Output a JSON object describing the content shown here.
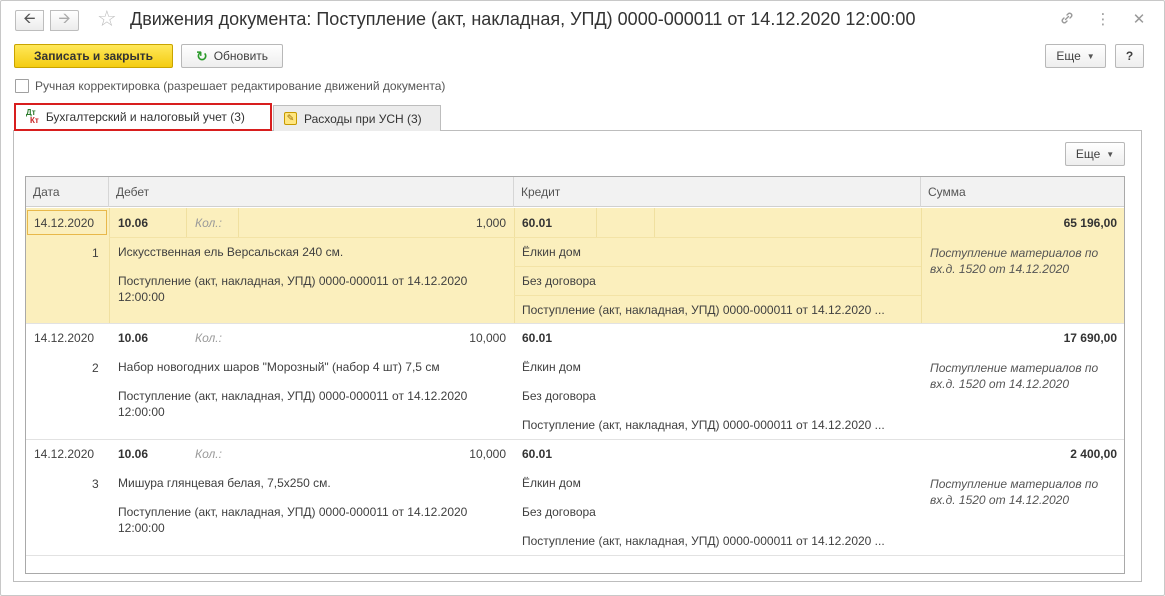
{
  "window": {
    "title": "Движения документа: Поступление (акт, накладная, УПД) 0000-000011 от 14.12.2020 12:00:00"
  },
  "toolbar": {
    "save_close_label": "Записать и закрыть",
    "refresh_label": "Обновить",
    "more_label": "Еще",
    "help_label": "?"
  },
  "manual_check": {
    "label": "Ручная корректировка (разрешает редактирование движений документа)",
    "checked": false
  },
  "tabs": [
    {
      "label": "Бухгалтерский и налоговый учет (3)",
      "icon_dt": "Дт",
      "icon_kt": "Кт",
      "active": true
    },
    {
      "label": "Расходы при УСН (3)",
      "active": false
    }
  ],
  "table_toolbar": {
    "more_label": "Еще"
  },
  "columns": {
    "date": "Дата",
    "debit": "Дебет",
    "credit": "Кредит",
    "sum": "Сумма"
  },
  "records": [
    {
      "date": "14.12.2020",
      "num": "1",
      "debit_account": "10.06",
      "qty_label": "Кол.:",
      "qty": "1,000",
      "debit_sub1": "Искусственная ель Версальская 240 см.",
      "debit_sub2_l1": "Поступление (акт, накладная, УПД) 0000-000011 от 14.12.2020",
      "debit_sub2_l2": "12:00:00",
      "credit_account": "60.01",
      "credit_sub1": "Ёлкин дом",
      "credit_sub2": "Без договора",
      "credit_sub3": "Поступление (акт, накладная, УПД) 0000-000011 от 14.12.2020 ...",
      "sum": "65 196,00",
      "content_l1": "Поступление материалов по",
      "content_l2": "вх.д. 1520 от 14.12.2020"
    },
    {
      "date": "14.12.2020",
      "num": "2",
      "debit_account": "10.06",
      "qty_label": "Кол.:",
      "qty": "10,000",
      "debit_sub1": "Набор новогодних шаров \"Морозный\" (набор 4 шт) 7,5 см",
      "debit_sub2_l1": "Поступление (акт, накладная, УПД) 0000-000011 от 14.12.2020",
      "debit_sub2_l2": "12:00:00",
      "credit_account": "60.01",
      "credit_sub1": "Ёлкин дом",
      "credit_sub2": "Без договора",
      "credit_sub3": "Поступление (акт, накладная, УПД) 0000-000011 от 14.12.2020 ...",
      "sum": "17 690,00",
      "content_l1": "Поступление материалов по",
      "content_l2": "вх.д. 1520 от 14.12.2020"
    },
    {
      "date": "14.12.2020",
      "num": "3",
      "debit_account": "10.06",
      "qty_label": "Кол.:",
      "qty": "10,000",
      "debit_sub1": "Мишура глянцевая белая, 7,5x250 см.",
      "debit_sub2_l1": "Поступление (акт, накладная, УПД) 0000-000011 от 14.12.2020",
      "debit_sub2_l2": "12:00:00",
      "credit_account": "60.01",
      "credit_sub1": "Ёлкин дом",
      "credit_sub2": "Без договора",
      "credit_sub3": "Поступление (акт, накладная, УПД) 0000-000011 от 14.12.2020 ...",
      "sum": "2 400,00",
      "content_l1": "Поступление материалов по",
      "content_l2": "вх.д. 1520 от 14.12.2020"
    }
  ]
}
